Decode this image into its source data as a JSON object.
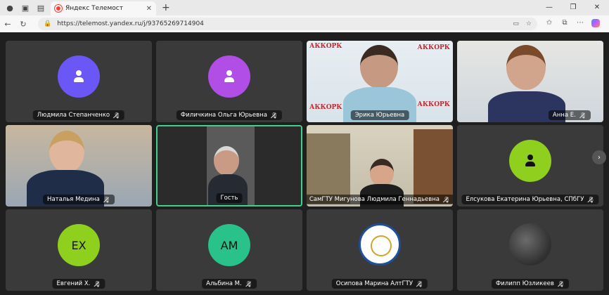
{
  "browser": {
    "tab_title": "Яндекс Телемост",
    "url": "https://telemost.yandex.ru/j/93765269714904"
  },
  "participants": [
    {
      "name": "Людмила Степанченко",
      "avatar_color": "#6b57f5",
      "initials": "",
      "kind": "placeholder"
    },
    {
      "name": "Филичкина Ольга Юрьевна",
      "avatar_color": "#b04ee6",
      "initials": "",
      "kind": "placeholder"
    },
    {
      "name": "Эрика Юрьевна",
      "kind": "video",
      "logo": "АККОРК"
    },
    {
      "name": "Анна Е.",
      "kind": "video"
    },
    {
      "name": "Наталья Медина",
      "kind": "video"
    },
    {
      "name": "Гость",
      "kind": "video",
      "active": true
    },
    {
      "name": "СамГТУ Мигунова Людмила Геннадьевна",
      "kind": "video"
    },
    {
      "name": "Елсукова Екатерина Юрьевна, СПбГУ",
      "avatar_color": "#8fcf1e",
      "initials": "",
      "kind": "placeholder"
    },
    {
      "name": "Евгений Х.",
      "avatar_color": "#8fcf1e",
      "initials": "ЕХ",
      "kind": "initials"
    },
    {
      "name": "Альбина М.",
      "avatar_color": "#29c28a",
      "initials": "АМ",
      "kind": "initials"
    },
    {
      "name": "Осипова Марина АлтГТУ",
      "kind": "seal"
    },
    {
      "name": "Филипп Юзликеев",
      "kind": "photo"
    }
  ]
}
